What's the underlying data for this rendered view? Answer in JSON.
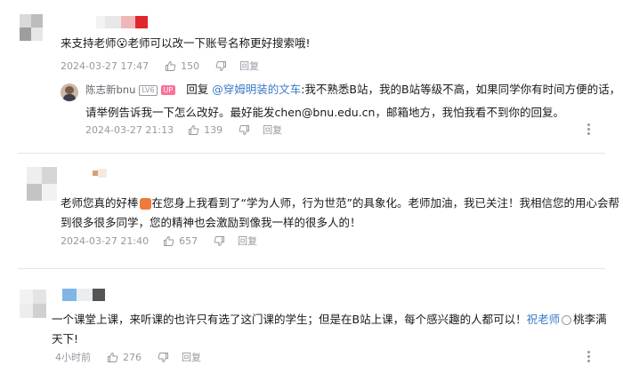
{
  "colors": {
    "mention": "#3c7ac9",
    "meta": "#9499a0",
    "up_badge": "#fb7299",
    "accent_red": "#e0262f"
  },
  "comments": [
    {
      "text": "来支持老师😮老师可以改一下账号名称更好搜索哦!",
      "date": "2024-03-27 17:47",
      "likes": "150",
      "reply_label": "回复",
      "reply": {
        "username": "陈志新bnu",
        "level_badge": "LV6",
        "up_badge": "UP",
        "prefix": "回复",
        "mention": "@穿姆明装的文车",
        "line1": ":我不熟悉B站，我的B站等级不高，如果同学你有时间方便的话，",
        "line2": "请举例告诉我一下怎么改好。最好能发chen@bnu.edu.cn，邮箱地方，我怕我看不到你的回复。",
        "date": "2024-03-27 21:13",
        "likes": "139",
        "reply_label": "回复"
      }
    },
    {
      "line1_a": "老师您真的好棒",
      "line1_b": "在您身上我看到了“学为人师，行为世范”的具象化。老师加油，我已关注！我相信您的用心会帮",
      "line2": "到很多很多同学，您的精神也会激励到像我一样的很多人的！",
      "date": "2024-03-27 21:40",
      "likes": "657",
      "reply_label": "回复"
    },
    {
      "line1_a": "一个课堂上课，来听课的也许只有选了这门课的学生；但是在B站上课，每个感兴趣的人都可以！",
      "line1_mention": "祝老师",
      "line1_b": "桃李满",
      "line2": "天下!",
      "date": "4小时前",
      "likes": "276",
      "reply_label": "回复"
    }
  ]
}
